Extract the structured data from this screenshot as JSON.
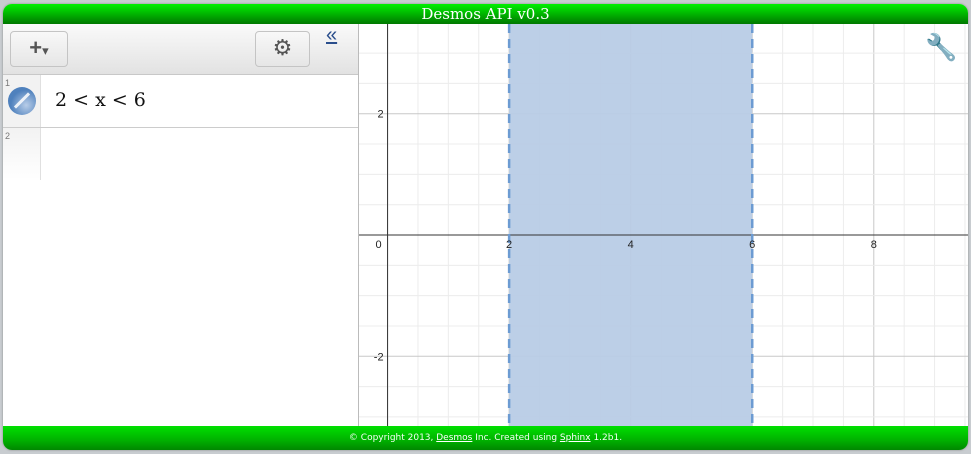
{
  "title": "Desmos API v0.3",
  "toolbar": {
    "add_icon": "+",
    "dropdown_icon": "▾",
    "settings_icon": "⚙",
    "collapse_icon": "«"
  },
  "expressions": [
    {
      "index": "1",
      "latex": "2 < x < 6",
      "color": "#4f81bd"
    },
    {
      "index": "2",
      "latex": ""
    }
  ],
  "graph": {
    "xmin": -0.47,
    "xmax": 9.55,
    "ymin": -3.15,
    "ymax": 3.48,
    "x_ticks": [
      "0",
      "2",
      "4",
      "6",
      "8"
    ],
    "y_ticks": [
      "2",
      "-2"
    ],
    "region": {
      "left": 2,
      "right": 6,
      "fill": "#b8cce6",
      "border": "#6c9bd2"
    }
  },
  "footer": {
    "prefix": "© Copyright 2013, ",
    "desmos": "Desmos",
    "middle": " Inc. Created using ",
    "sphinx": "Sphinx",
    "suffix": " 1.2b1."
  }
}
